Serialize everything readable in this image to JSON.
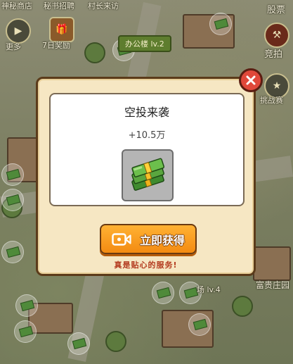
{
  "background": {
    "top_labels": [
      "神秘商店",
      "秘书招聘",
      "村长来访",
      "股票"
    ],
    "left_buttons": [
      "更多",
      "7日奖励"
    ],
    "banner": "办公楼 lv.2",
    "right_buttons": [
      "竞拍",
      "挑战赛"
    ],
    "lower_labels": [
      "富贵庄园",
      "场 lv.4"
    ]
  },
  "dialog": {
    "title": "空投来袭",
    "amount": "+10.5万",
    "reward_icon": "cash-stack-icon",
    "get_button_label": "立即获得",
    "get_button_icon": "video-camera-icon",
    "caption": "真是贴心的服务!",
    "close_icon": "close-x-icon"
  },
  "colors": {
    "dialog_bg": "#f6e7c3",
    "button_orange": "#f38b12",
    "close_red": "#e0483a",
    "caption_red": "#b33a1e"
  }
}
